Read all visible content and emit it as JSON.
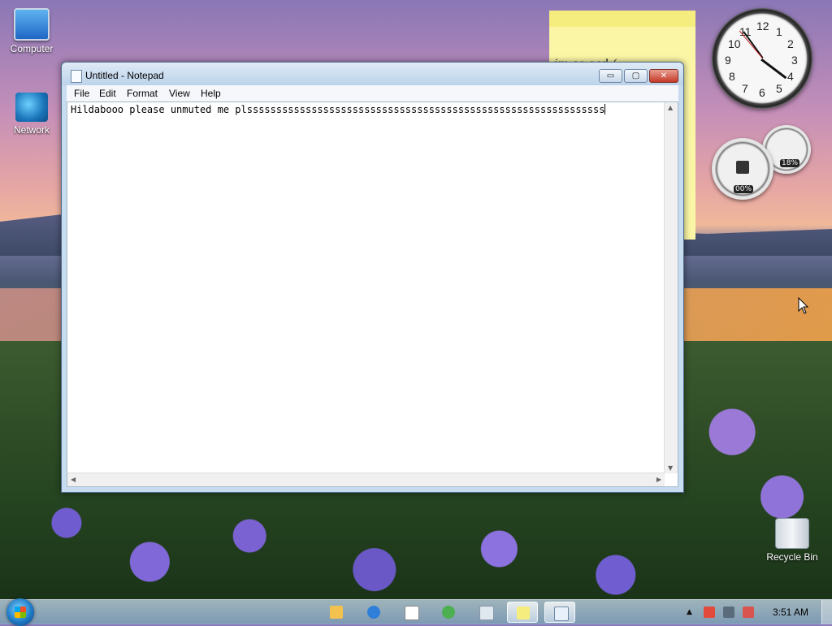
{
  "desktop": {
    "icons": [
      {
        "label": "Computer",
        "icon": "computer-icon"
      },
      {
        "label": "Network",
        "icon": "network-icon"
      },
      {
        "label": "Recycle Bin",
        "icon": "recycle-bin-icon"
      }
    ]
  },
  "sticky_note": {
    "text": "im so sad:("
  },
  "gadgets": {
    "clock": {
      "numbers": [
        "12",
        "1",
        "2",
        "3",
        "4",
        "5",
        "6",
        "7",
        "8",
        "9",
        "10",
        "11"
      ]
    },
    "cpu_meter": {
      "cpu": "00%",
      "memory": "18%"
    }
  },
  "notepad": {
    "title": "Untitled - Notepad",
    "menu": [
      "File",
      "Edit",
      "Format",
      "View",
      "Help"
    ],
    "content": "Hildabooo please unmuted me plsssssssssssssssssssssssssssssssssssssssssssssssssssssssssssss",
    "buttons": {
      "minimize": "▭",
      "maximize": "▢",
      "close": "✕"
    }
  },
  "taskbar": {
    "clock": "3:51 AM",
    "pinned": [
      {
        "name": "explorer",
        "icon": "folder-icon",
        "color": "#f2c14e"
      },
      {
        "name": "internet-explorer",
        "icon": "ie-icon",
        "color": "#2f7fd8"
      },
      {
        "name": "solitaire",
        "icon": "cards-icon",
        "color": "#ffffff"
      },
      {
        "name": "media-center",
        "icon": "media-center-icon",
        "color": "#4caf50"
      },
      {
        "name": "calculator",
        "icon": "calculator-icon",
        "color": "#dfe7ef"
      },
      {
        "name": "sticky-notes",
        "icon": "sticky-notes-icon",
        "color": "#f6ed7f"
      },
      {
        "name": "notepad",
        "icon": "notepad-icon",
        "color": "#e8f1fb"
      }
    ],
    "tray": [
      "show-hidden-icons",
      "action-center-icon",
      "network-icon",
      "volume-icon"
    ]
  }
}
